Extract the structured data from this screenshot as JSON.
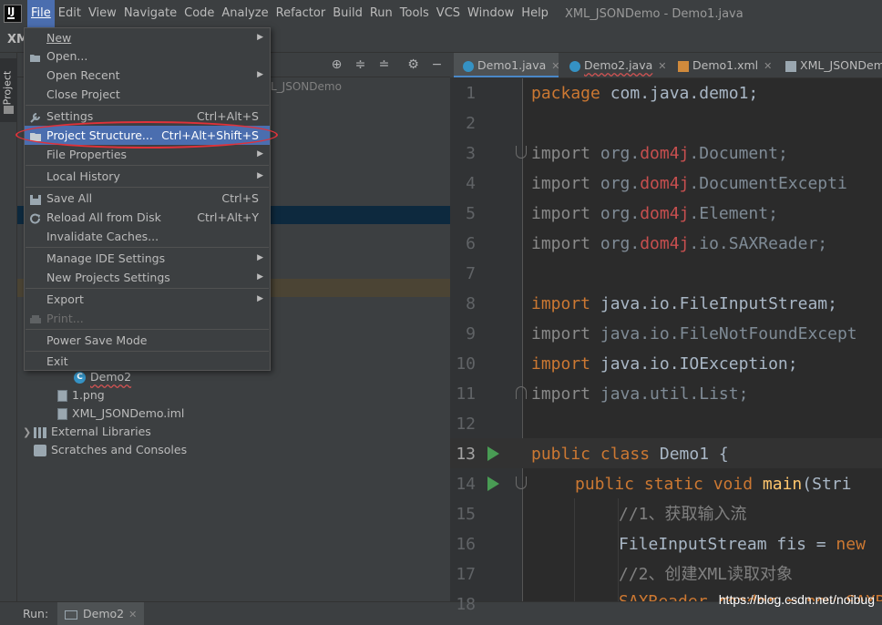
{
  "menubar": {
    "items": [
      "File",
      "Edit",
      "View",
      "Navigate",
      "Code",
      "Analyze",
      "Refactor",
      "Build",
      "Run",
      "Tools",
      "VCS",
      "Window",
      "Help"
    ],
    "active": "File",
    "window_title": "XML_JSONDemo - Demo1.java",
    "logo_text": "IJ"
  },
  "navbar": {
    "project_name": "XM"
  },
  "side_tab": {
    "label": "Project"
  },
  "project_panel": {
    "breadcrumb_hint": "L_JSONDemo",
    "tree": [
      {
        "label": "Demo2",
        "icon": "class-icon"
      },
      {
        "label": "1.png",
        "icon": "file-icon"
      },
      {
        "label": "XML_JSONDemo.iml",
        "icon": "file-icon"
      },
      {
        "label": "External Libraries",
        "icon": "library-icon"
      },
      {
        "label": "Scratches and Consoles",
        "icon": "scratch-icon"
      }
    ]
  },
  "file_menu": {
    "items": [
      {
        "label": "New",
        "shortcut": "",
        "submenu": true
      },
      {
        "label": "Open...",
        "shortcut": "",
        "submenu": false
      },
      {
        "label": "Open Recent",
        "shortcut": "",
        "submenu": true
      },
      {
        "label": "Close Project",
        "shortcut": "",
        "submenu": false
      },
      {
        "label": "Settings",
        "shortcut": "Ctrl+Alt+S",
        "submenu": false
      },
      {
        "label": "Project Structure...",
        "shortcut": "Ctrl+Alt+Shift+S",
        "submenu": false
      },
      {
        "label": "File Properties",
        "shortcut": "",
        "submenu": true
      },
      {
        "label": "Local History",
        "shortcut": "",
        "submenu": true
      },
      {
        "label": "Save All",
        "shortcut": "Ctrl+S",
        "submenu": false
      },
      {
        "label": "Reload All from Disk",
        "shortcut": "Ctrl+Alt+Y",
        "submenu": false
      },
      {
        "label": "Invalidate Caches...",
        "shortcut": "",
        "submenu": false
      },
      {
        "label": "Manage IDE Settings",
        "shortcut": "",
        "submenu": true
      },
      {
        "label": "New Projects Settings",
        "shortcut": "",
        "submenu": true
      },
      {
        "label": "Export",
        "shortcut": "",
        "submenu": true
      },
      {
        "label": "Print...",
        "shortcut": "",
        "submenu": false
      },
      {
        "label": "Power Save Mode",
        "shortcut": "",
        "submenu": false
      },
      {
        "label": "Exit",
        "shortcut": "",
        "submenu": false
      }
    ],
    "selected": "Project Structure...",
    "disabled": [
      "Print..."
    ]
  },
  "editor": {
    "tabs": [
      {
        "label": "Demo1.java",
        "icon": "java-class-icon",
        "active": true
      },
      {
        "label": "Demo2.java",
        "icon": "java-class-icon",
        "active": false
      },
      {
        "label": "Demo1.xml",
        "icon": "xml-file-icon",
        "active": false
      },
      {
        "label": "XML_JSONDemo",
        "icon": "module-file-icon",
        "active": false
      }
    ],
    "line_numbers": [
      "1",
      "2",
      "3",
      "4",
      "5",
      "6",
      "7",
      "8",
      "9",
      "10",
      "11",
      "12",
      "13",
      "14",
      "15",
      "16",
      "17",
      "18"
    ],
    "current_line": "13",
    "code": {
      "l1_kw": "package",
      "l1_rest": " com.java.demo1;",
      "l3_kw": "import",
      "l3_a": " org.",
      "l3_pkg": "dom4j",
      "l3_b": ".Document;",
      "l4_kw": "import",
      "l4_a": " org.",
      "l4_pkg": "dom4j",
      "l4_b": ".DocumentExcepti",
      "l5_kw": "import",
      "l5_a": " org.",
      "l5_pkg": "dom4j",
      "l5_b": ".Element;",
      "l6_kw": "import",
      "l6_a": " org.",
      "l6_pkg": "dom4j",
      "l6_b": ".io.SAXReader;",
      "l8_kw": "import",
      "l8_rest": " java.io.FileInputStream;",
      "l9_kw": "import",
      "l9_rest": " java.io.FileNotFoundExcept",
      "l10_kw": "import",
      "l10_rest": " java.io.IOException;",
      "l11_kw": "import",
      "l11_rest": " java.util.List;",
      "l13_kw": "public class",
      "l13_cls": " Demo1",
      "l13_rest": " {",
      "l14_kw": "public static void",
      "l14_fn": " main",
      "l14_rest": "(Stri",
      "l15": "//1、获取输入流",
      "l16_a": "FileInputStream fis = ",
      "l16_kw": "new",
      "l17": "//2、创建XML读取对象",
      "l18": "SAXReader reader = new SAXR"
    }
  },
  "bottom_bar": {
    "run_label": "Run:",
    "run_tab": "Demo2"
  },
  "watermark": "https://blog.csdn.net/noibug",
  "colors": {
    "accent": "#4b6eaf",
    "highlight_ellipse": "#e0323a",
    "keyword": "#cc7832",
    "run_icon": "#499c54"
  }
}
